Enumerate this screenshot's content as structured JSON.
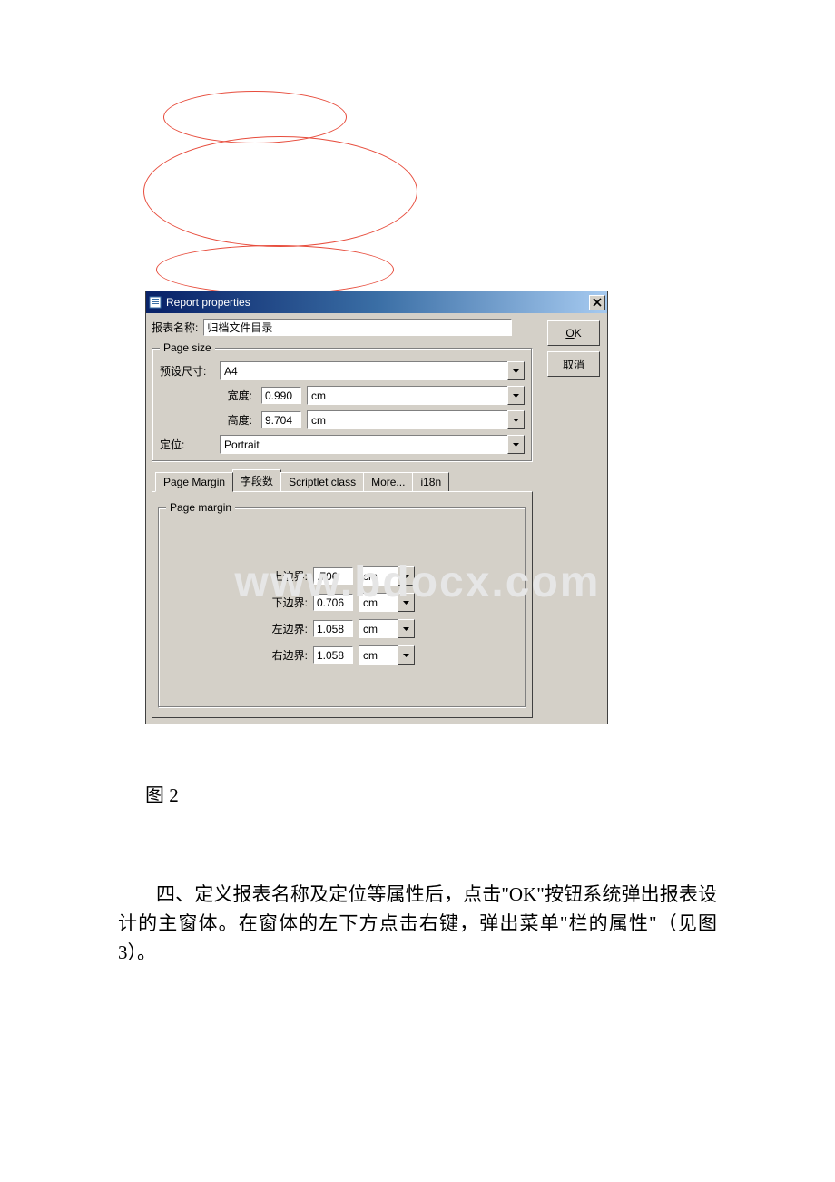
{
  "watermark": "www.bdocx.com",
  "dialog": {
    "title": "Report properties",
    "buttons": {
      "ok": "OK",
      "ok_underline": "O",
      "cancel": "取消"
    },
    "report_name_label": "报表名称:",
    "report_name_value": "归档文件目录",
    "page_size": {
      "legend": "Page size",
      "preset_label": "预设尺寸:",
      "preset_value": "A4",
      "width_label": "宽度:",
      "width_value": "0.990",
      "height_label": "高度:",
      "height_value": "9.704",
      "unit": "cm",
      "orient_label": "定位:",
      "orient_value": "Portrait"
    },
    "tabs": {
      "page_margin": "Page Margin",
      "fields": "字段数",
      "scriptlet": "Scriptlet class",
      "more": "More...",
      "i18n": "i18n"
    },
    "page_margin_panel": {
      "legend": "Page margin",
      "top_label": "上边界:",
      "top_value": ".706",
      "bottom_label": "下边界:",
      "bottom_value": "0.706",
      "left_label": "左边界:",
      "left_value": "1.058",
      "right_label": "右边界:",
      "right_value": "1.058",
      "unit": "cm"
    }
  },
  "caption": "图 2",
  "paragraph": "四、定义报表名称及定位等属性后，点击\"OK\"按钮系统弹出报表设计的主窗体。在窗体的左下方点击右键，弹出菜单\"栏的属性\"（见图 3）。"
}
